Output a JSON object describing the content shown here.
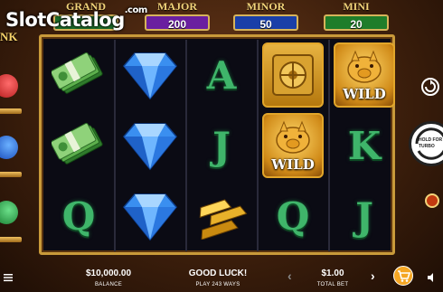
{
  "watermark": {
    "text": "SlotCatalog",
    "domain": ".com"
  },
  "jackpots": [
    {
      "label": "GRAND",
      "value": "",
      "color": "#1c6b2a"
    },
    {
      "label": "MAJOR",
      "value": "200",
      "color": "#6a1fa0"
    },
    {
      "label": "MINOR",
      "value": "50",
      "color": "#1a3fa8"
    },
    {
      "label": "MINI",
      "value": "20",
      "color": "#1f7d2a"
    }
  ],
  "side_logo": {
    "line1": "NK"
  },
  "reels": [
    [
      "cash-stack",
      "cash-stack",
      "q-letter"
    ],
    [
      "diamond",
      "diamond",
      "diamond"
    ],
    [
      "a-letter",
      "j-letter",
      "gold-bars"
    ],
    [
      "vault",
      "wild-pig",
      "q-letter"
    ],
    [
      "wild-pig",
      "k-letter",
      "j-letter"
    ]
  ],
  "symbols": {
    "q_letter": "Q",
    "a_letter": "A",
    "j_letter": "J",
    "k_letter": "K",
    "wild": "WILD"
  },
  "controls": {
    "hold_label_1": "HOLD FOR",
    "hold_label_2": "TURBO"
  },
  "bottom": {
    "balance_value": "$10,000.00",
    "balance_label": "BALANCE",
    "status_text": "GOOD LUCK!",
    "ways_text": "PLAY 243 WAYS",
    "bet_value": "$1.00",
    "bet_label": "TOTAL BET",
    "left_arrow": "‹",
    "right_arrow": "›"
  },
  "colors": {
    "accent": "#f3d47a",
    "frame": "#c99a3a",
    "spin_button": "#ffffff",
    "cart_button": "#f5a623"
  }
}
